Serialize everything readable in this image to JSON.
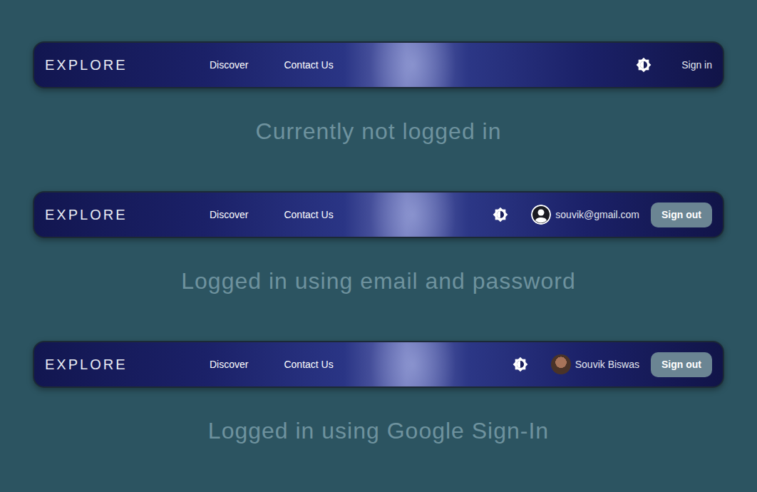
{
  "states": [
    {
      "brand": "EXPLORE",
      "links": [
        {
          "label": "Discover"
        },
        {
          "label": "Contact Us"
        }
      ],
      "auth": {
        "kind": "signed-out",
        "sign_in": "Sign in"
      },
      "caption": "Currently not logged in"
    },
    {
      "brand": "EXPLORE",
      "links": [
        {
          "label": "Discover"
        },
        {
          "label": "Contact Us"
        }
      ],
      "auth": {
        "kind": "email",
        "user": "souvik@gmail.com",
        "sign_out": "Sign out"
      },
      "caption": "Logged in using email and password"
    },
    {
      "brand": "EXPLORE",
      "links": [
        {
          "label": "Discover"
        },
        {
          "label": "Contact Us"
        }
      ],
      "auth": {
        "kind": "google",
        "user": "Souvik Biswas",
        "sign_out": "Sign out"
      },
      "caption": "Logged in using Google Sign-In"
    }
  ]
}
